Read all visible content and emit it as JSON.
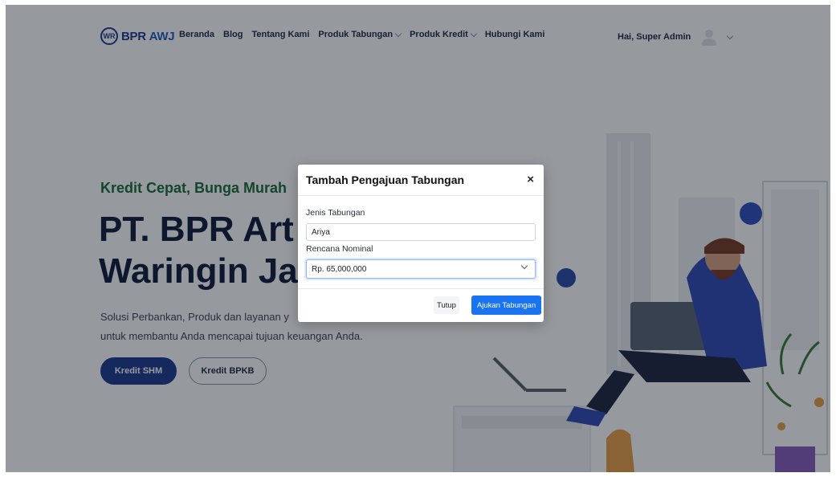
{
  "navbar": {
    "logo_icon": "WR",
    "logo_main": "BPR ",
    "logo_accent": "AWJ",
    "items": [
      {
        "label": "Beranda"
      },
      {
        "label": "Blog"
      },
      {
        "label": "Tentang Kami"
      },
      {
        "label": "Produk Tabungan"
      },
      {
        "label": "Produk Kredit"
      },
      {
        "label": "Hubungi Kami"
      }
    ],
    "greeting": "Hai, Super Admin"
  },
  "hero": {
    "tagline": "Kredit Cepat, Bunga Murah",
    "title_line1": "PT. BPR Art",
    "title_line2": "Waringin Ja",
    "desc_line1": "Solusi Perbankan, Produk dan layanan y",
    "desc_line2": "untuk membantu Anda mencapai tujuan keuangan Anda.",
    "primary_btn": "Kredit SHM",
    "outline_btn": "Kredit BPKB"
  },
  "modal": {
    "title": "Tambah Pengajuan Tabungan",
    "close": "×",
    "field1_label": "Jenis Tabungan",
    "field1_value": "Ariya",
    "field2_label": "Rencana Nominal",
    "field2_value": "Rp. 65,000,000",
    "cancel_btn": "Tutup",
    "submit_btn": "Ajukan Tabungan"
  },
  "colors": {
    "brand": "#1f3a93",
    "tagline": "#1b6b3a",
    "submit": "#1a73f0"
  }
}
